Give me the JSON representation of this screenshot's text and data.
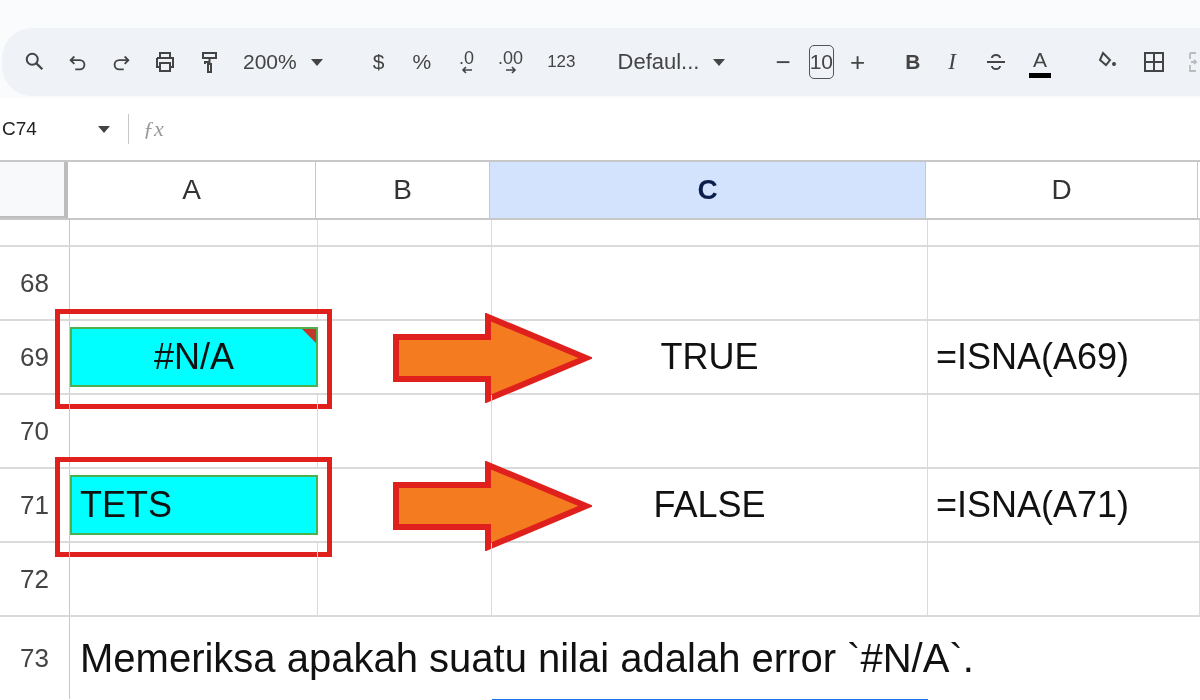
{
  "toolbar": {
    "zoom": "200%",
    "currency": "$",
    "percent": "%",
    "decrease_decimal": ".0",
    "increase_decimal": ".00",
    "number_format": "123",
    "font": "Defaul...",
    "font_size_decrease": "−",
    "font_size": "10",
    "font_size_increase": "+",
    "bold": "B",
    "italic": "I",
    "text_color": "A",
    "merge": {
      "disabled": true
    }
  },
  "name_box": "C74",
  "formula_label": "ƒx",
  "columns": [
    {
      "label": "A",
      "selected": false
    },
    {
      "label": "B",
      "selected": false
    },
    {
      "label": "C",
      "selected": true
    },
    {
      "label": "D",
      "selected": false
    }
  ],
  "rows": [
    {
      "number": "68",
      "cells": [
        "",
        "",
        "",
        ""
      ]
    },
    {
      "number": "69",
      "cells": [
        "#N/A",
        "",
        "TRUE",
        "=ISNA(A69)"
      ],
      "cyan": true,
      "centered": true,
      "error": true,
      "highlighted": true,
      "arrow": true
    },
    {
      "number": "70",
      "cells": [
        "",
        "",
        "",
        ""
      ]
    },
    {
      "number": "71",
      "cells": [
        "TETS",
        "",
        "FALSE",
        "=ISNA(A71)"
      ],
      "cyan": true,
      "centered": false,
      "error": false,
      "highlighted": true,
      "arrow": true
    },
    {
      "number": "72",
      "cells": [
        "",
        "",
        "",
        ""
      ]
    },
    {
      "number": "73",
      "text": "Memeriksa apakah suatu nilai adalah error `#N/A`."
    }
  ]
}
